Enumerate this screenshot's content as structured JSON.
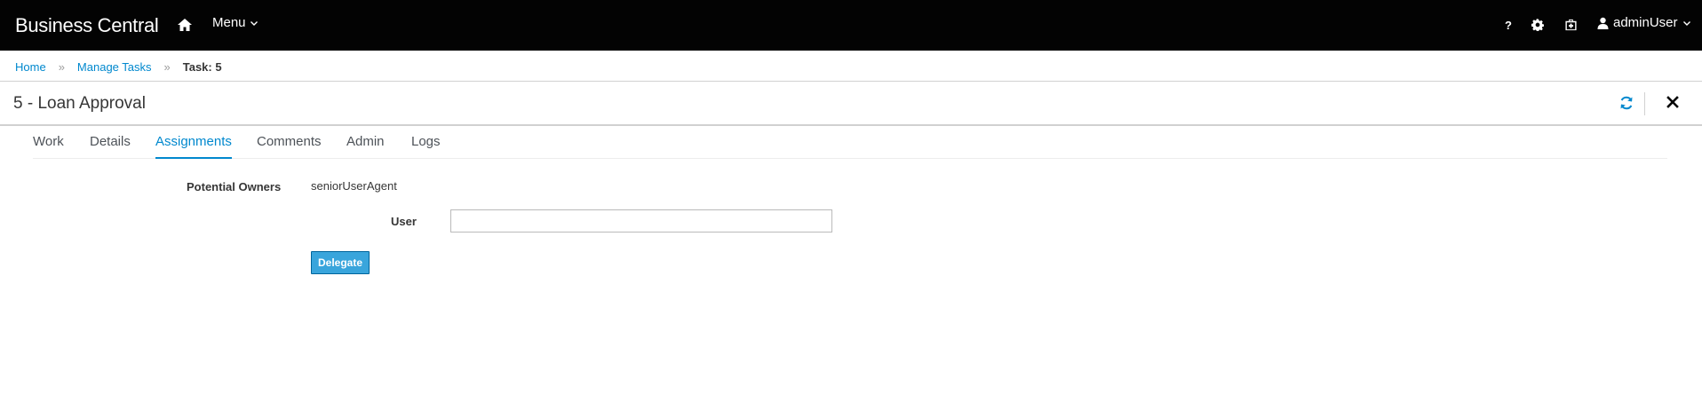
{
  "topbar": {
    "brand": "Business Central",
    "home_icon": "home-icon",
    "menu_label": "Menu",
    "help_label": "?",
    "settings_icon": "gear-icon",
    "apps_icon": "briefcase-icon",
    "user_label": "adminUser"
  },
  "breadcrumb": {
    "items": [
      "Home",
      "Manage Tasks"
    ],
    "separator": "»",
    "current": "Task: 5"
  },
  "page": {
    "title": "5 - Loan Approval",
    "refresh_icon": "refresh-icon",
    "close_icon": "close-icon"
  },
  "tabs": [
    {
      "label": "Work",
      "active": false
    },
    {
      "label": "Details",
      "active": false
    },
    {
      "label": "Assignments",
      "active": true
    },
    {
      "label": "Comments",
      "active": false
    },
    {
      "label": "Admin",
      "active": false
    },
    {
      "label": "Logs",
      "active": false
    }
  ],
  "assignments": {
    "potential_owners_label": "Potential Owners",
    "potential_owners_value": "seniorUserAgent",
    "user_label": "User",
    "user_value": "",
    "delegate_label": "Delegate"
  },
  "colors": {
    "topbar_bg": "#030303",
    "link": "#0088ce",
    "button_bg": "#39a5dc"
  }
}
